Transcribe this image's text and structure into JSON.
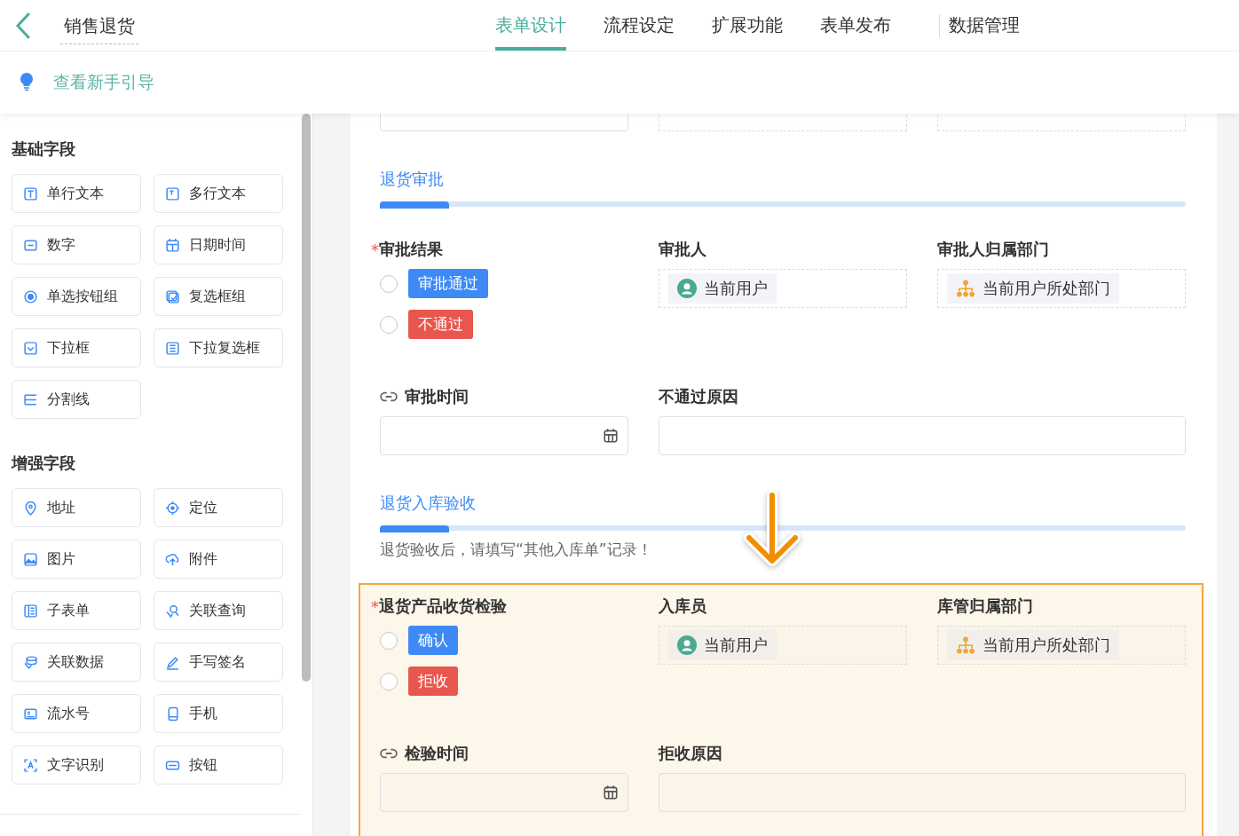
{
  "header": {
    "title": "销售退货",
    "tabs": [
      {
        "label": "表单设计",
        "selected": true
      },
      {
        "label": "流程设定",
        "selected": false
      },
      {
        "label": "扩展功能",
        "selected": false
      },
      {
        "label": "表单发布",
        "selected": false
      },
      {
        "label": "数据管理",
        "selected": false
      }
    ]
  },
  "guide_link": "查看新手引导",
  "palette": [
    {
      "title": "基础字段",
      "items": [
        {
          "label": "单行文本",
          "kind": "text"
        },
        {
          "label": "多行文本",
          "kind": "textarea"
        },
        {
          "label": "数字",
          "kind": "number"
        },
        {
          "label": "日期时间",
          "kind": "date"
        },
        {
          "label": "单选按钮组",
          "kind": "radio"
        },
        {
          "label": "复选框组",
          "kind": "checkbox"
        },
        {
          "label": "下拉框",
          "kind": "select"
        },
        {
          "label": "下拉复选框",
          "kind": "multiselect"
        },
        {
          "label": "分割线",
          "kind": "divider"
        }
      ]
    },
    {
      "title": "增强字段",
      "items": [
        {
          "label": "地址",
          "kind": "address"
        },
        {
          "label": "定位",
          "kind": "location"
        },
        {
          "label": "图片",
          "kind": "image"
        },
        {
          "label": "附件",
          "kind": "upload"
        },
        {
          "label": "子表单",
          "kind": "subform"
        },
        {
          "label": "关联查询",
          "kind": "query"
        },
        {
          "label": "关联数据",
          "kind": "relation"
        },
        {
          "label": "手写签名",
          "kind": "signature"
        },
        {
          "label": "流水号",
          "kind": "serial"
        },
        {
          "label": "手机",
          "kind": "phone"
        },
        {
          "label": "文字识别",
          "kind": "ocr"
        },
        {
          "label": "按钮",
          "kind": "button"
        }
      ]
    }
  ],
  "sections": [
    {
      "title": "退货审批",
      "highlighted": false,
      "fields": [
        {
          "kind": "radio",
          "label": "审批结果",
          "required_mark": "*",
          "options": [
            {
              "label": "审批通过",
              "color": "#3d8af7",
              "selected": false
            },
            {
              "label": "不通过",
              "color": "#e8574e",
              "selected": false
            }
          ]
        },
        {
          "kind": "user",
          "label": "审批人",
          "value": "当前用户"
        },
        {
          "kind": "dept",
          "label": "审批人归属部门",
          "value": "当前用户所处部门"
        },
        {
          "kind": "date",
          "label": "审批时间"
        },
        {
          "kind": "wide-text",
          "label": "不通过原因"
        }
      ]
    },
    {
      "title": "退货入库验收",
      "highlighted": true,
      "note": "退货验收后，请填写“其他入库单”记录！",
      "fields": [
        {
          "kind": "radio",
          "label": "退货产品收货检验",
          "required_mark": "*",
          "options": [
            {
              "label": "确认",
              "color": "#3d8af7",
              "selected": false
            },
            {
              "label": "拒收",
              "color": "#e8574e",
              "selected": false
            }
          ]
        },
        {
          "kind": "user",
          "label": "入库员",
          "value": "当前用户"
        },
        {
          "kind": "dept",
          "label": "库管归属部门",
          "value": "当前用户所处部门"
        },
        {
          "kind": "date",
          "label": "检验时间"
        },
        {
          "kind": "wide-text",
          "label": "拒收原因"
        }
      ]
    }
  ]
}
